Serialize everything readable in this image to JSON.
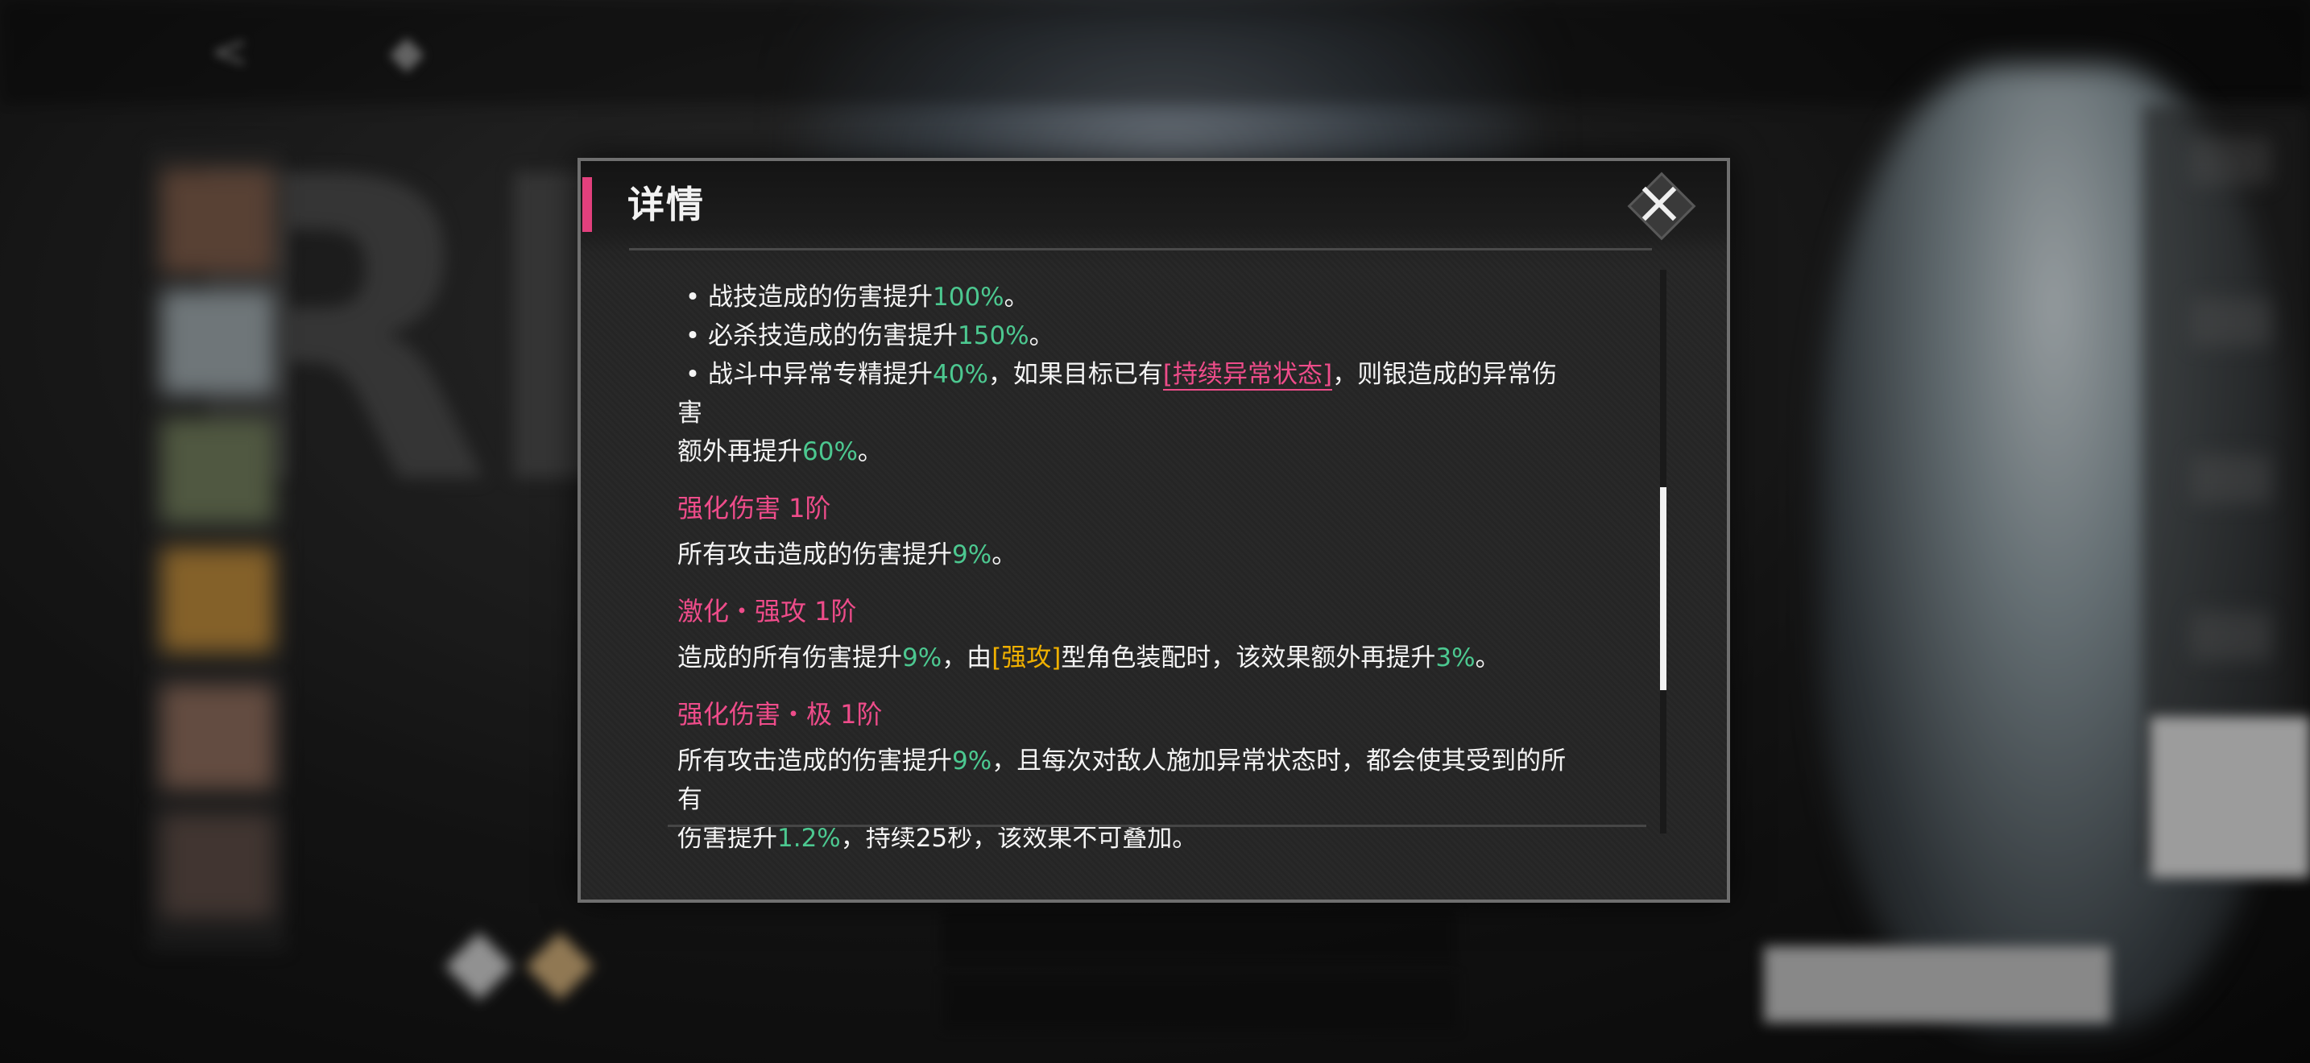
{
  "dialog": {
    "title": "详情",
    "close_icon": "close-x-icon"
  },
  "bullets": [
    {
      "dot": "•",
      "parts": [
        [
          "战技造成的伤害提升",
          ""
        ],
        [
          "100%",
          "g"
        ],
        [
          "。",
          ""
        ]
      ]
    },
    {
      "dot": "•",
      "parts": [
        [
          "必杀技造成的伤害提升",
          ""
        ],
        [
          "150%",
          "g"
        ],
        [
          "。",
          ""
        ]
      ]
    },
    {
      "dot": "•",
      "parts": [
        [
          "战斗中异常专精提升",
          ""
        ],
        [
          "40%",
          "g"
        ],
        [
          "，如果目标已有",
          ""
        ],
        [
          "[持续异常状态]",
          "kw-pink"
        ],
        [
          "，则银造成的异常伤害",
          ""
        ]
      ]
    },
    {
      "dot": "",
      "parts": [
        [
          "额外再提升",
          ""
        ],
        [
          "60%",
          "g"
        ],
        [
          "。",
          ""
        ]
      ]
    }
  ],
  "sections": [
    {
      "title": "强化伤害 1阶",
      "lines": [
        [
          [
            "所有攻击造成的伤害提升",
            ""
          ],
          [
            "9%",
            "g"
          ],
          [
            "。",
            ""
          ]
        ]
      ]
    },
    {
      "title": "激化・强攻 1阶",
      "lines": [
        [
          [
            "造成的所有伤害提升",
            ""
          ],
          [
            "9%",
            "g"
          ],
          [
            "，由",
            ""
          ],
          [
            "[强攻]",
            "kw-yellow"
          ],
          [
            "型角色装配时，该效果额外再提升",
            ""
          ],
          [
            "3%",
            "g"
          ],
          [
            "。",
            ""
          ]
        ]
      ]
    },
    {
      "title": "强化伤害・极 1阶",
      "lines": [
        [
          [
            "所有攻击造成的伤害提升",
            ""
          ],
          [
            "9%",
            "g"
          ],
          [
            "，且每次对敌人施加异常状态时，都会使其受到的所有",
            ""
          ]
        ],
        [
          [
            "伤害提升",
            ""
          ],
          [
            "1.2%",
            "g"
          ],
          [
            "，持续25秒，该效果不可叠加。",
            ""
          ]
        ]
      ]
    }
  ],
  "colors": {
    "accent_pink": "#e2407d",
    "value_green": "#4cc890",
    "keyword_yellow": "#f0b000"
  },
  "scroll": {
    "thumb_fraction": 0.36
  }
}
